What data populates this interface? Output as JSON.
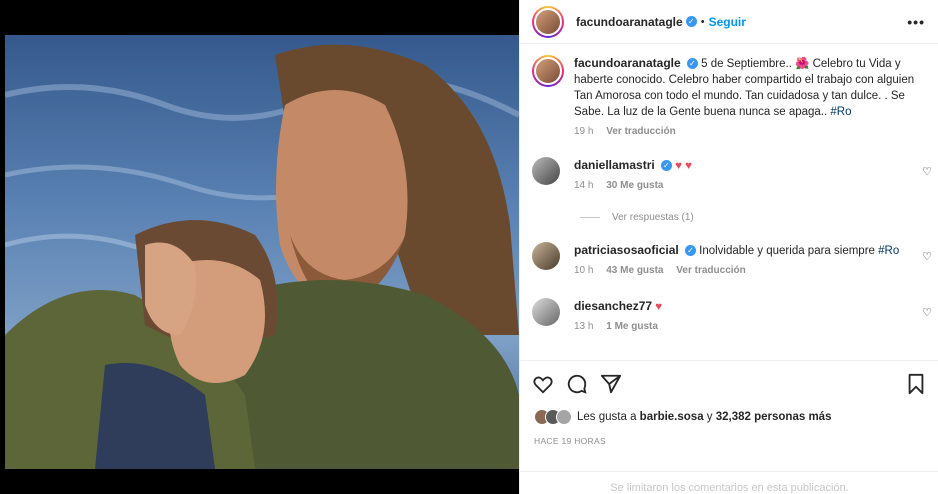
{
  "header": {
    "username": "facundoaranatagle",
    "separator": "•",
    "follow_label": "Seguir",
    "more_label": "•••"
  },
  "caption": {
    "username": "facundoaranatagle",
    "text": "5 de Septiembre.. 🌺 Celebro tu Vida y haberte conocido. Celebro haber compartido el trabajo con alguien Tan Amorosa con todo el mundo. Tan cuidadosa y tan dulce. . Se Sabe. La luz de la Gente buena nunca se apaga..",
    "hashtag": "#Ro",
    "time": "19 h",
    "translate": "Ver traducción"
  },
  "comments": [
    {
      "username": "daniellamastri",
      "text": "♥ ♥",
      "time": "14 h",
      "likes": "30 Me gusta",
      "reply": ""
    },
    {
      "username": "patriciasosaoficial",
      "text": "Inolvidable y querida para siempre",
      "hashtag": "#Ro",
      "time": "10 h",
      "likes": "43 Me gusta",
      "reply": "Ver traducción"
    },
    {
      "username": "diesanchez77",
      "text": "♥",
      "time": "13 h",
      "likes": "1 Me gusta",
      "reply": ""
    }
  ],
  "replies_label": "Ver respuestas (1)",
  "likes": {
    "prefix": "Les gusta a",
    "user": "barbie.sosa",
    "middle": "y",
    "count": "32,382 personas más"
  },
  "time_ago": "HACE 19 HORAS",
  "comments_disabled": "Se limitaron los comentarios en esta publicación.",
  "icons": [
    "heart-icon",
    "comment-icon",
    "share-icon",
    "bookmark-icon",
    "verified-icon",
    "like-icon"
  ],
  "colors": {
    "accent": "#0095f6",
    "heart": "#ed4956",
    "verified": "#3897f0"
  }
}
